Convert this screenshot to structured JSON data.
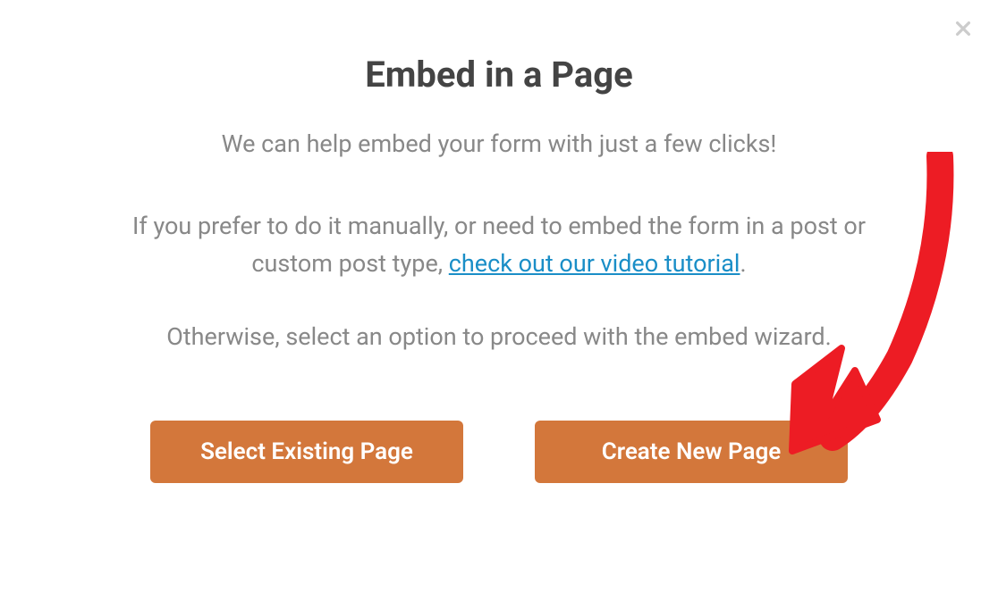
{
  "modal": {
    "title": "Embed in a Page",
    "subtitle": "We can help embed your form with just a few clicks!",
    "paragraph1_part1": "If you prefer to do it manually, or need to embed the form in a post or custom post type, ",
    "paragraph1_link": "check out our video tutorial",
    "paragraph1_part2": ".",
    "paragraph2": "Otherwise, select an option to proceed with the embed wizard.",
    "buttons": {
      "select_existing": "Select Existing Page",
      "create_new": "Create New Page"
    }
  },
  "colors": {
    "primary": "#d3773b",
    "link": "#1a8ec7",
    "title": "#444444",
    "text": "#888888",
    "annotation": "#ed1c24"
  }
}
